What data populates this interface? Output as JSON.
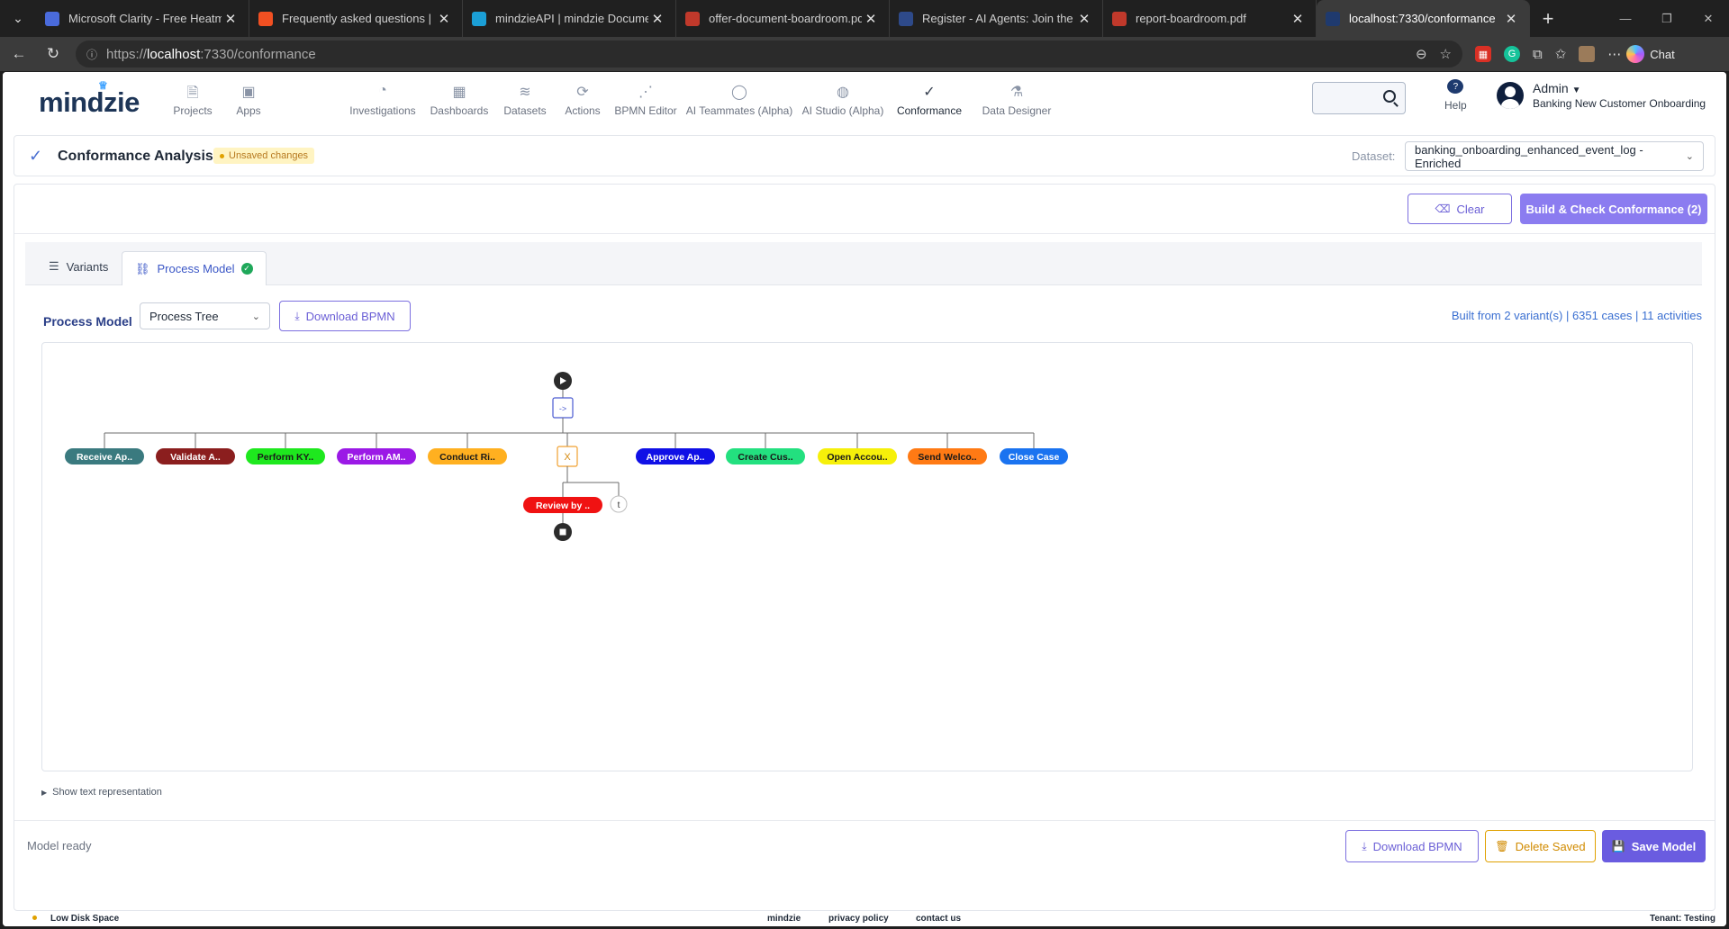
{
  "browser": {
    "tabs": [
      {
        "label": "Microsoft Clarity - Free Heatmaps",
        "color": "#4a6bdc",
        "active": false
      },
      {
        "label": "Frequently asked questions | Micr",
        "color": "#f25022",
        "active": false
      },
      {
        "label": "mindzieAPI | mindzie Documentat",
        "color": "#1b9fd6",
        "active": false
      },
      {
        "label": "offer-document-boardroom.pdf",
        "color": "#c0392b",
        "active": false
      },
      {
        "label": "Register - AI Agents: Join the Club",
        "color": "#2e4a8a",
        "active": false
      },
      {
        "label": "report-boardroom.pdf",
        "color": "#c0392b",
        "active": false
      },
      {
        "label": "localhost:7330/conformance",
        "color": "#1f3a6e",
        "active": true
      }
    ],
    "url_prefix": "https://",
    "url_host": "localhost",
    "url_path": ":7330/conformance",
    "chat_label": "Chat"
  },
  "nav": {
    "logo": "mindzie",
    "items": [
      {
        "label": "Projects",
        "icon": "document-icon"
      },
      {
        "label": "Apps",
        "icon": "apps-icon"
      },
      {
        "label": "Investigations",
        "icon": "chart-pie-icon"
      },
      {
        "label": "Dashboards",
        "icon": "grid-icon"
      },
      {
        "label": "Datasets",
        "icon": "database-icon"
      },
      {
        "label": "Actions",
        "icon": "refresh-icon"
      },
      {
        "label": "BPMN Editor",
        "icon": "flow-icon"
      },
      {
        "label": "AI Teammates (Alpha)",
        "icon": "chat-icon"
      },
      {
        "label": "AI Studio (Alpha)",
        "icon": "globe-icon"
      },
      {
        "label": "Conformance",
        "icon": "check-icon"
      },
      {
        "label": "Data Designer",
        "icon": "flask-icon"
      }
    ],
    "active": "Conformance",
    "help_label": "Help",
    "user_name": "Admin",
    "user_project": "Banking New Customer Onboarding"
  },
  "header": {
    "title": "Conformance Analysis",
    "unsaved_badge": "Unsaved changes",
    "dataset_label": "Dataset:",
    "dataset_value": "banking_onboarding_enhanced_event_log - Enriched"
  },
  "toolbar": {
    "clear_label": "Clear",
    "build_label": "Build & Check Conformance (2)"
  },
  "tabs": {
    "variants_label": "Variants",
    "process_model_label": "Process Model"
  },
  "model": {
    "label": "Process Model",
    "view_select": "Process Tree",
    "download_label": "Download BPMN",
    "built_info": "Built from 2 variant(s) | 6351 cases | 11 activities",
    "show_text": "Show text representation"
  },
  "tree": {
    "sequence_label": "->",
    "xor_label": "X",
    "tau_label": "t",
    "activities": [
      {
        "label": "Receive Ap..",
        "color": "#3a7a7f",
        "text_color": "#ffffff"
      },
      {
        "label": "Validate A..",
        "color": "#8b1e1e",
        "text_color": "#ffffff"
      },
      {
        "label": "Perform KY..",
        "color": "#1ee81e",
        "text_color": "#1a1a1a"
      },
      {
        "label": "Perform AM..",
        "color": "#9b19e6",
        "text_color": "#ffffff"
      },
      {
        "label": "Conduct Ri..",
        "color": "#ffb020",
        "text_color": "#1a1a1a"
      },
      {
        "label": "Approve Ap..",
        "color": "#1010e6",
        "text_color": "#ffffff"
      },
      {
        "label": "Create Cus..",
        "color": "#23e07f",
        "text_color": "#1a1a1a"
      },
      {
        "label": "Open Accou..",
        "color": "#f6f00a",
        "text_color": "#1a1a1a"
      },
      {
        "label": "Send Welco..",
        "color": "#ff7a14",
        "text_color": "#1a1a1a"
      },
      {
        "label": "Close Case",
        "color": "#1a73f0",
        "text_color": "#ffffff"
      }
    ],
    "optional_activity": {
      "label": "Review by ..",
      "color": "#f01212",
      "text_color": "#ffffff"
    }
  },
  "footer": {
    "status": "Model ready",
    "download_label": "Download BPMN",
    "delete_label": "Delete Saved",
    "save_label": "Save Model"
  },
  "statusbar": {
    "warning": "Low Disk Space",
    "brand": "mindzie",
    "privacy": "privacy policy",
    "contact": "contact us",
    "tenant": "Tenant: Testing"
  }
}
